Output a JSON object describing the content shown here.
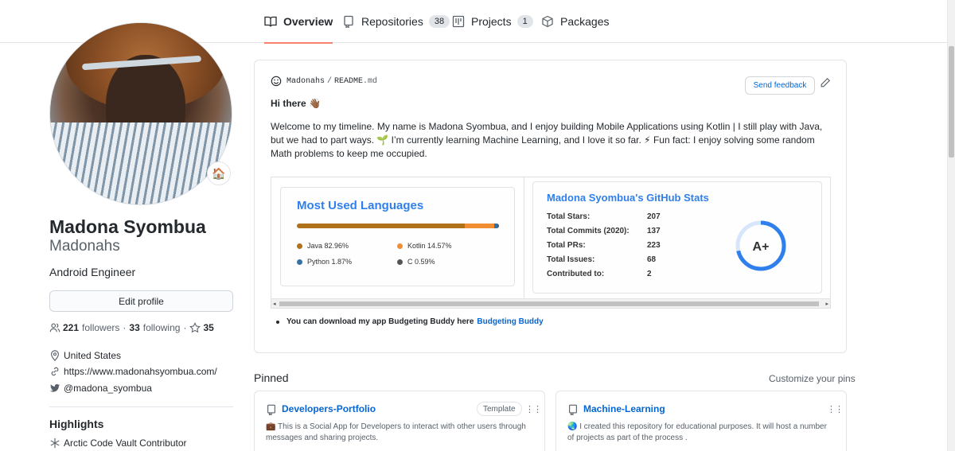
{
  "tabs": [
    {
      "label": "Overview",
      "icon": "book-icon"
    },
    {
      "label": "Repositories",
      "count": "38",
      "icon": "repo-icon"
    },
    {
      "label": "Projects",
      "count": "1",
      "icon": "project-icon"
    },
    {
      "label": "Packages",
      "icon": "package-icon"
    }
  ],
  "profile": {
    "name": "Madona Syombua",
    "login": "Madonahs",
    "bio": "Android Engineer",
    "status_emoji": "🏠",
    "edit_label": "Edit profile",
    "followers_count": "221",
    "followers_label": "followers",
    "following_count": "33",
    "following_label": "following",
    "stars_count": "35",
    "location": "United States",
    "website": "https://www.madonahsyombua.com/",
    "twitter": "@madona_syombua",
    "highlights_title": "Highlights",
    "highlight_item": "Arctic Code Vault Contributor"
  },
  "readme": {
    "owner": "Madonahs",
    "separator": "/",
    "file": "README",
    "ext": ".md",
    "feedback_label": "Send feedback",
    "greeting": "Hi there 👋🏾",
    "welcome": "Welcome to my timeline. My name is Madona Syombua, and I enjoy building Mobile Applications using Kotlin | I still play with Java, but we had to part ways. 🌱 I’m currently learning Machine Learning, and I love it so far. ⚡ Fun fact: I enjoy solving some random Math problems to keep me occupied.",
    "bullet_text": "You can download my app Budgeting Buddy here",
    "bullet_link": "Budgeting Buddy"
  },
  "languages_card": {
    "title": "Most Used Languages",
    "items": [
      {
        "label": "Java 82.96%",
        "percent": 82.96,
        "color": "#b07219"
      },
      {
        "label": "Kotlin 14.57%",
        "percent": 14.57,
        "color": "#F18E33"
      },
      {
        "label": "Python 1.87%",
        "percent": 1.87,
        "color": "#3572A5"
      },
      {
        "label": "C 0.59%",
        "percent": 0.59,
        "color": "#555555"
      }
    ]
  },
  "stats_card": {
    "title": "Madona Syombua's GitHub Stats",
    "rows": [
      {
        "label": "Total Stars:",
        "value": "207"
      },
      {
        "label": "Total Commits (2020):",
        "value": "137"
      },
      {
        "label": "Total PRs:",
        "value": "223"
      },
      {
        "label": "Total Issues:",
        "value": "68"
      },
      {
        "label": "Contributed to:",
        "value": "2"
      }
    ],
    "grade": "A+",
    "ring_color": "#2f80ed"
  },
  "pinned": {
    "label": "Pinned",
    "customize_label": "Customize your pins",
    "cards": [
      {
        "title": "Developers-Portfolio",
        "badge": "Template",
        "description": "💼 This is a Social App for Developers to interact with other users through messages and sharing projects."
      },
      {
        "title": "Machine-Learning",
        "description": "🌏 I created this repository for educational purposes. It will host a number of projects as part of the process ."
      }
    ]
  },
  "colors": {
    "accent": "#0366d6",
    "tab_underline": "#f9826c",
    "text": "#24292e",
    "muted": "#586069"
  }
}
